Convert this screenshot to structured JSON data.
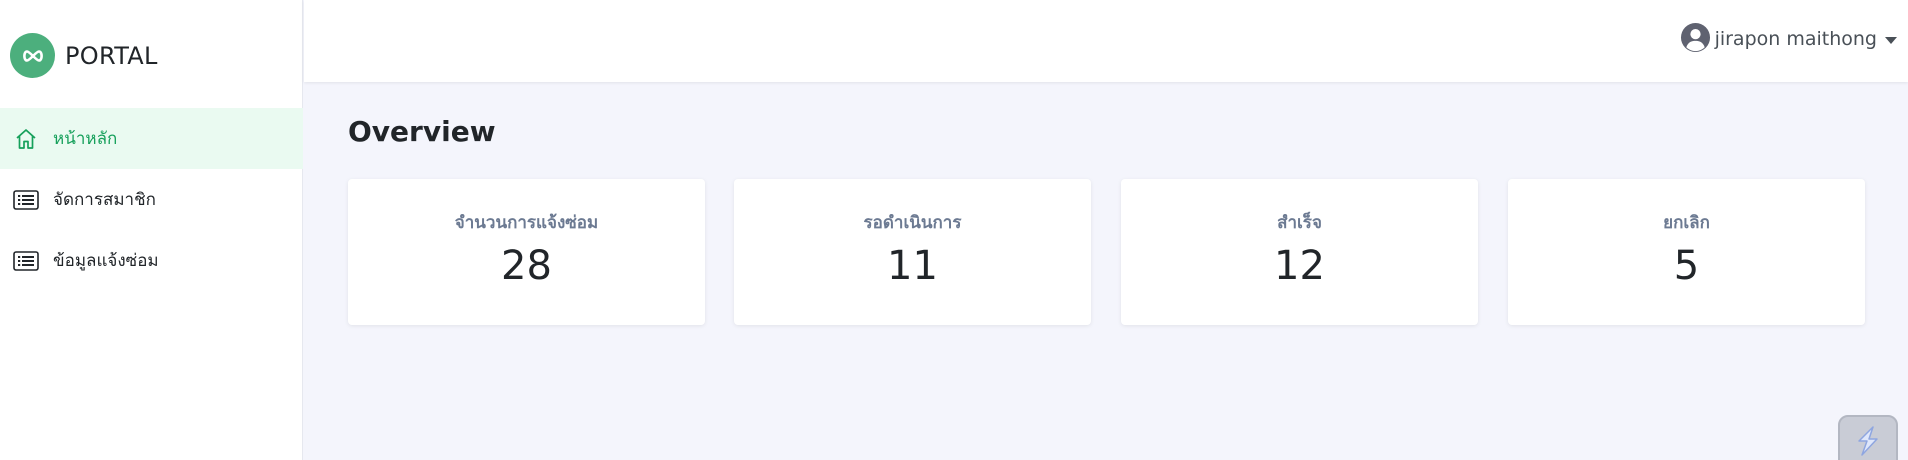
{
  "brand": {
    "name": "PORTAL",
    "logo_icon": "infinity-icon",
    "logo_color": "#4caf7d"
  },
  "sidebar": {
    "items": [
      {
        "label": "หน้าหลัก",
        "icon": "home-icon",
        "active": true
      },
      {
        "label": "จัดการสมาชิก",
        "icon": "list-icon",
        "active": false
      },
      {
        "label": "ข้อมูลแจ้งซ่อม",
        "icon": "list-icon",
        "active": false
      }
    ]
  },
  "header": {
    "user_name": "jirapon maithong",
    "user_icon": "user-circle-icon"
  },
  "main": {
    "title": "Overview",
    "cards": [
      {
        "label": "จำนวนการแจ้งซ่อม",
        "value": "28"
      },
      {
        "label": "รอดำเนินการ",
        "value": "11"
      },
      {
        "label": "สำเร็จ",
        "value": "12"
      },
      {
        "label": "ยกเลิก",
        "value": "5"
      }
    ]
  },
  "colors": {
    "accent": "#16a05b",
    "active_bg": "#eafaf1",
    "page_bg": "#f4f5fc",
    "card_label": "#6c7a92"
  }
}
